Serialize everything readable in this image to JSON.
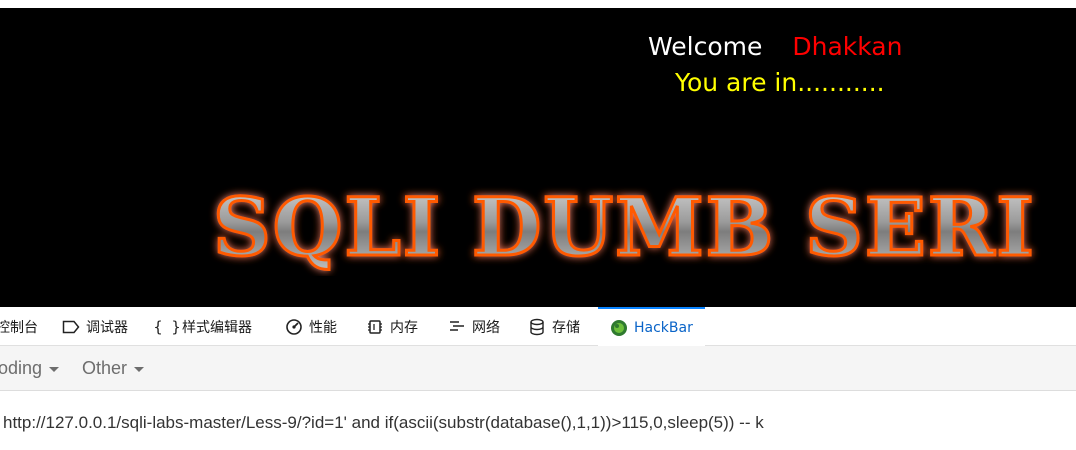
{
  "page": {
    "welcome_word": "Welcome",
    "welcome_name": "Dhakkan",
    "status_message": "You are in...........",
    "banner_title": "SQLI DUMB SERI"
  },
  "devtools": {
    "tabs": [
      {
        "label": "控制台",
        "icon": "console-icon"
      },
      {
        "label": "调试器",
        "icon": "debugger-icon"
      },
      {
        "label": "样式编辑器",
        "icon": "braces-icon"
      },
      {
        "label": "性能",
        "icon": "performance-icon"
      },
      {
        "label": "内存",
        "icon": "memory-icon"
      },
      {
        "label": "网络",
        "icon": "network-icon"
      },
      {
        "label": "存储",
        "icon": "storage-icon"
      },
      {
        "label": "HackBar",
        "icon": "hackbar-icon",
        "active": true
      }
    ]
  },
  "hackbar": {
    "menus": [
      {
        "label": "oding"
      },
      {
        "label": "Other"
      }
    ],
    "url_value": "http://127.0.0.1/sqli-labs-master/Less-9/?id=1' and if(ascii(substr(database(),1,1))>115,0,sleep(5)) -- k"
  },
  "colors": {
    "welcome": "#ffffff",
    "name": "#ff0000",
    "status": "#ffff00",
    "banner_glow": "#ff5a00",
    "active_tab": "#0a64c8"
  }
}
